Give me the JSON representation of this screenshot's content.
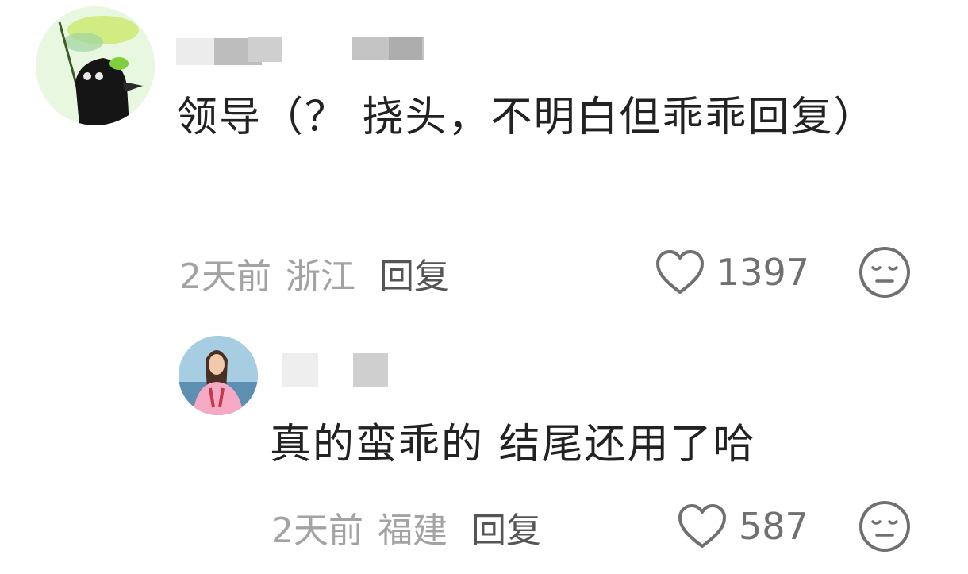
{
  "comments": [
    {
      "text": "领导（？ 挠头，不明白但乖乖回复）",
      "time": "2天前",
      "location": "浙江",
      "reply_label": "回复",
      "likes": "1397",
      "avatar_icon": "cartoon-character-avatar-icon"
    },
    {
      "text": "真的蛮乖的 结尾还用了哈",
      "time": "2天前",
      "location": "福建",
      "reply_label": "回复",
      "likes": "587",
      "avatar_icon": "person-photo-avatar-icon"
    }
  ],
  "icons": {
    "like": "heart-outline-icon",
    "reaction": "neutral-face-icon"
  },
  "colors": {
    "meta": "#a3a3a3",
    "reply": "#555555",
    "text": "#222222",
    "icon": "#707070"
  }
}
